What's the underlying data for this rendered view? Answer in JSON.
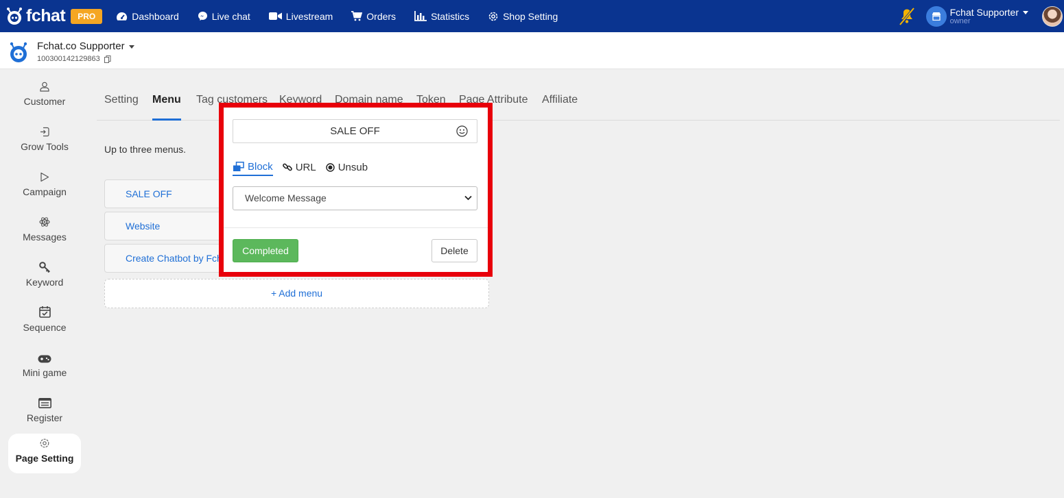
{
  "app": {
    "logo_text": "fchat",
    "plan_badge": "PRO",
    "nav": [
      {
        "label": "Dashboard",
        "icon": "dashboard-icon"
      },
      {
        "label": "Live chat",
        "icon": "messenger-icon"
      },
      {
        "label": "Livestream",
        "icon": "video-icon"
      },
      {
        "label": "Orders",
        "icon": "cart-icon"
      },
      {
        "label": "Statistics",
        "icon": "bar-chart-icon"
      },
      {
        "label": "Shop Setting",
        "icon": "gear-icon"
      }
    ],
    "user": {
      "name": "Fchat Supporter",
      "role": "owner"
    }
  },
  "page": {
    "name": "Fchat.co Supporter",
    "id": "100300142129863"
  },
  "sidebar": {
    "items": [
      {
        "label": "Customer",
        "icon": "user-icon"
      },
      {
        "label": "Grow Tools",
        "icon": "login-icon"
      },
      {
        "label": "Campaign",
        "icon": "play-icon"
      },
      {
        "label": "Messages",
        "icon": "atom-icon"
      },
      {
        "label": "Keyword",
        "icon": "key-icon"
      },
      {
        "label": "Sequence",
        "icon": "calendar-check-icon"
      },
      {
        "label": "Mini game",
        "icon": "gamepad-icon"
      },
      {
        "label": "Register",
        "icon": "list-icon"
      },
      {
        "label": "Page Setting",
        "icon": "gear-icon",
        "active": true
      }
    ]
  },
  "tabs": [
    {
      "label": "Setting"
    },
    {
      "label": "Menu",
      "active": true
    },
    {
      "label": "Tag customers"
    },
    {
      "label": "Keyword"
    },
    {
      "label": "Domain name"
    },
    {
      "label": "Token"
    },
    {
      "label": "Page Attribute"
    },
    {
      "label": "Affiliate"
    }
  ],
  "menu": {
    "hint": "Up to three menus.",
    "items": [
      "SALE OFF",
      "Website",
      "Create Chatbot by Fchat"
    ],
    "add_label": "+ Add menu"
  },
  "popup": {
    "title_value": "SALE OFF",
    "types": [
      {
        "label": "Block",
        "icon": "block-icon",
        "active": true
      },
      {
        "label": "URL",
        "icon": "link-icon"
      },
      {
        "label": "Unsub",
        "icon": "radio-icon"
      }
    ],
    "selected_block": "Welcome Message",
    "complete_label": "Completed",
    "delete_label": "Delete"
  },
  "colors": {
    "nav_bg": "#0a3490",
    "accent": "#1f6fd6",
    "highlight_border": "#e8000b",
    "complete_btn": "#5cb85c",
    "badge": "#f5a623"
  }
}
